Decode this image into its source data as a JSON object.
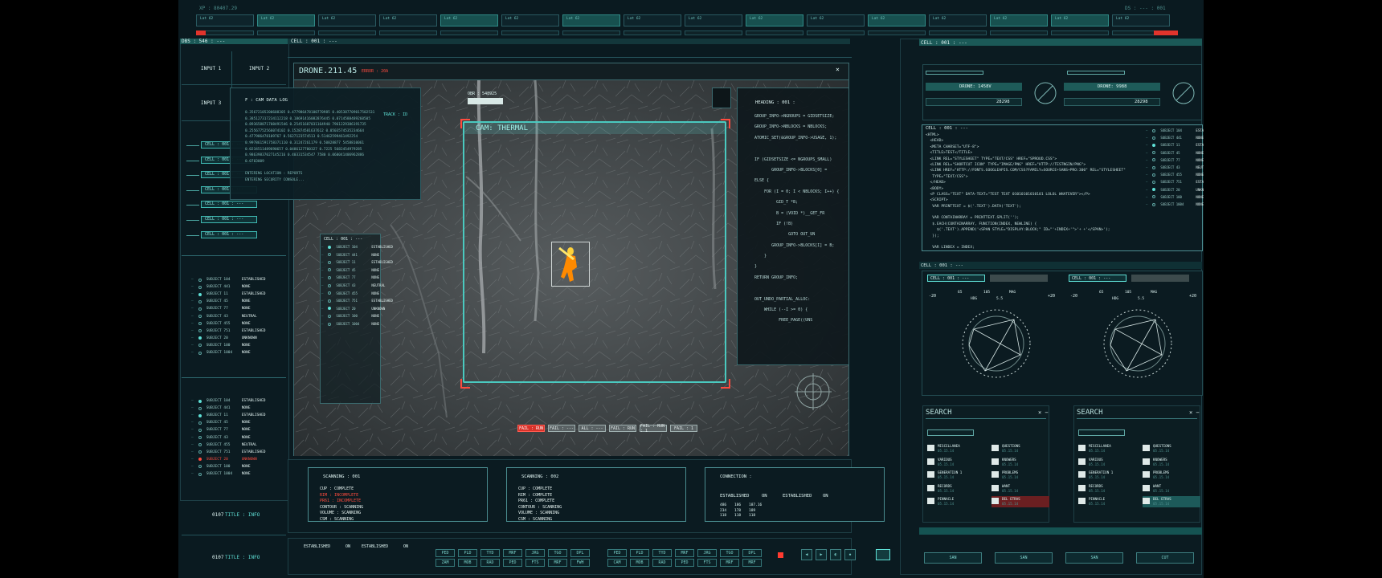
{
  "top": {
    "left_id": "XP : 80407.29",
    "right_id": "DS : --- : 001",
    "lat_label": "Lat 62",
    "lat_boxes": 16
  },
  "left": {
    "header": "DBS : 546 : ---",
    "input1": "INPUT 1",
    "input2": "INPUT 2",
    "input3": "INPUT 3",
    "cells": [
      "CELL : 001 : ---",
      "CELL : 001 : ---",
      "CELL : 001 : ---",
      "CELL : 001 : ---",
      "CELL : 001 : ---",
      "CELL : 001 : ---",
      "CELL : 001 : ---"
    ],
    "subjects_a": [
      {
        "name": "SUBJECT 104",
        "status": "ESTABLISHED",
        "state": "off"
      },
      {
        "name": "SUBJECT 441",
        "status": "NONE",
        "state": "off"
      },
      {
        "name": "SUBJECT 11",
        "status": "ESTABLISHED",
        "state": "on"
      },
      {
        "name": "SUBJECT 45",
        "status": "NONE",
        "state": "off"
      },
      {
        "name": "SUBJECT 77",
        "status": "NONE",
        "state": "off"
      },
      {
        "name": "SUBJECT 43",
        "status": "NEUTRAL",
        "state": "off"
      },
      {
        "name": "SUBJECT 455",
        "status": "NONE",
        "state": "off"
      },
      {
        "name": "SUBJECT 751",
        "status": "ESTABLISHED",
        "state": "off"
      },
      {
        "name": "SUBJECT 20",
        "status": "UNKNOWN",
        "state": "on"
      },
      {
        "name": "SUBJECT 100",
        "status": "NONE",
        "state": "off"
      },
      {
        "name": "SUBJECT 1004",
        "status": "NONE",
        "state": "off"
      }
    ],
    "subjects_b": [
      {
        "name": "SUBJECT 104",
        "status": "ESTABLISHED",
        "state": "on"
      },
      {
        "name": "SUBJECT 441",
        "status": "NONE",
        "state": "off"
      },
      {
        "name": "SUBJECT 11",
        "status": "ESTABLISHED",
        "state": "on"
      },
      {
        "name": "SUBJECT 45",
        "status": "NONE",
        "state": "off"
      },
      {
        "name": "SUBJECT 77",
        "status": "NONE",
        "state": "off"
      },
      {
        "name": "SUBJECT 43",
        "status": "NONE",
        "state": "off"
      },
      {
        "name": "SUBJECT 455",
        "status": "NEUTRAL",
        "state": "off"
      },
      {
        "name": "SUBJECT 751",
        "status": "ESTABLISHED",
        "state": "off"
      },
      {
        "name": "SUBJECT 20",
        "status": "UNKNOWN",
        "state": "red"
      },
      {
        "name": "SUBJECT 100",
        "status": "NONE",
        "state": "off"
      },
      {
        "name": "SUBJECT 1004",
        "status": "NONE",
        "state": "off"
      }
    ],
    "info1_id": "0107",
    "info1_label": "TITLE : INFO",
    "info2_id": "0107",
    "info2_label": "TITLE : INFO"
  },
  "center": {
    "header": "CELL : 001 : ---",
    "drone_title": "DRONE.211.45",
    "drone_sub": "ERROR : 20A",
    "cam_label": "CAM: THERMAL",
    "obr_label": "OBR : 548925",
    "track_label": "TRACK : ID",
    "datalog": {
      "title": "F : CAM DATA LOG",
      "lines": [
        "0.35672105200608305 0.477986478100770985 0.405387709017502531",
        "0.385127317234112218 0.18691416082876445 0.0714588489260505",
        "0.893658871708491546 0.25451687031164940 7961229386191735",
        "0.25567752566074102 0.152874581637612 0.0503574535234664",
        "0.477986478109767 0.5627123574513 0.51462599461492254",
        "0.997861591758371110 0.31247261179 0.50828877 5458810061",
        "0.0234511489690657 0.0486127700327 0.7225 5682454979285",
        "0.98639837027145216 0.40331534547 7580 0.060041406962886",
        "0.0703009",
        "",
        "ENTERING LOCATION : REPORTS",
        "ENTERING SECURITY CONSOLE..."
      ]
    },
    "subject_list_title": "CELL : 001 : ---",
    "subject_list": [
      {
        "name": "SUBJECT 104",
        "status": "ESTABLISHED",
        "state": "on"
      },
      {
        "name": "SUBJECT 441",
        "status": "NONE",
        "state": "off"
      },
      {
        "name": "SUBJECT 11",
        "status": "ESTABLISHED",
        "state": "off"
      },
      {
        "name": "SUBJECT 45",
        "status": "NONE",
        "state": "off"
      },
      {
        "name": "SUBJECT 77",
        "status": "NONE",
        "state": "off"
      },
      {
        "name": "SUBJECT 43",
        "status": "NEUTRAL",
        "state": "off"
      },
      {
        "name": "SUBJECT 455",
        "status": "NONE",
        "state": "off"
      },
      {
        "name": "SUBJECT 751",
        "status": "ESTABLISHED",
        "state": "off"
      },
      {
        "name": "SUBJECT 20",
        "status": "UNKNOWN",
        "state": "on"
      },
      {
        "name": "SUBJECT 100",
        "status": "NONE",
        "state": "off"
      },
      {
        "name": "SUBJECT 1004",
        "status": "NONE",
        "state": "off"
      }
    ],
    "heading_title": "HEADING : 001 :",
    "heading_code": [
      "GROUP_INFO->NGROUPS = GIDSETSIZE;",
      "GROUP_INFO->NBLOCKS = NBLOCKS;",
      "ATOMIC_SET(&GROUP_INFO->USAGE, 1);",
      "",
      "IF (GIDSETSIZE <= NGROUPS_SMALL)",
      "       GROUP_INFO->BLOCKS[0] =",
      "ELSE {",
      "    FOR (I = 0; I < NBLOCKS; I++) {",
      "         GID_T *B;",
      "         B = (VOID *)__GET_FR",
      "         IF (!B)",
      "              GOTO OUT_UN",
      "       GROUP_INFO->BLOCKS[I] = B;",
      "    }",
      "}",
      "RETURN GROUP_INFO;",
      "",
      "OUT_UNDO_PARTIAL_ALLOC:",
      "    WHILE (--I >= 0) {",
      "          FREE_PAGE((UNS"
    ],
    "bottom_buttons": [
      "FAIL : RUN",
      "FAIL : ---",
      "ALL : ---",
      "FAIL : RUN",
      "FAIL : RUN : 1",
      "FAIL : 1"
    ],
    "scan1": {
      "title": "SCANNING : 001",
      "lines": [
        {
          "t": "CUP : COMPLETE",
          "c": "white"
        },
        {
          "t": "RIM : INCOMPLETE",
          "c": "red"
        },
        {
          "t": "PR61 : INCOMPLETE",
          "c": "red"
        },
        {
          "t": "CONTOUR : SCANNING",
          "c": "white"
        },
        {
          "t": "VOLUME : SCANNING",
          "c": "white"
        },
        {
          "t": "CSM : SCANNING",
          "c": "white"
        }
      ]
    },
    "scan2": {
      "title": "SCANNING : 002",
      "lines": [
        {
          "t": "CUP : COMPLETE",
          "c": "white"
        },
        {
          "t": "RIM : COMPLETE",
          "c": "white"
        },
        {
          "t": "PR61 : COMPLETE",
          "c": "white"
        },
        {
          "t": "CONTOUR : SCANNING",
          "c": "white"
        },
        {
          "t": "VOLUME : SCANNING",
          "c": "white"
        },
        {
          "t": "CSM : SCANNING",
          "c": "white"
        }
      ]
    },
    "connection": {
      "title": "CONNECTION :",
      "est1": "ESTABLISHED",
      "on1": "ON",
      "est2": "ESTABLISHED",
      "on2": "ON",
      "row1": [
        "486",
        "186",
        "187.16"
      ],
      "row2": [
        "234",
        "178",
        "189"
      ],
      "row3": [
        "118",
        "118",
        "118"
      ]
    },
    "ctl_row1": [
      "PED",
      "PLD",
      "TYD",
      "MRF",
      "JRG",
      "TGO",
      "DPL"
    ],
    "ctl_row2": [
      "ZAM",
      "MOB",
      "RAD",
      "PED",
      "FTS",
      "MRF",
      "FWH"
    ],
    "ctl2_row1": [
      "PED",
      "PLD",
      "TYD",
      "MRF",
      "JRG",
      "TGO",
      "DPL"
    ],
    "ctl2_row2": [
      "CAM",
      "MOB",
      "RAD",
      "PED",
      "FTS",
      "MRF",
      "MRF"
    ],
    "est_bottom": [
      "ESTABLISHED",
      "ON",
      "ESTABLISHED",
      "ON"
    ]
  },
  "right": {
    "header": "CELL : 001 : ---",
    "drone1": "DRONE: 1458V",
    "drone1_val": "28298",
    "drone2": "DRONE: 9988",
    "drone2_val": "28298",
    "code_title": "CELL : 001 : ---",
    "code_lines": [
      "<HTML>",
      "  <HEAD>",
      "  <META CHARSET=\"UTF-8\">",
      "  <TITLE>TEST</TITLE>",
      "  <LINK REL=\"STYLESHEET\" TYPE=\"TEXT/CSS\" HREF=\"SPROUD.CSS\">",
      "  <LINK REL=\"SHORTCUT ICON\" TYPE=\"IMAGE/PNG\" HREF=\"HTTP://TESTNGIN/PNG\">",
      "  <LINK HREF=\"HTTP://FONTS.GOOGLEAPIS.COM/CSS?FAMILY=SOURCE+SANS+PRO:300\" REL=\"STYLESHEET\"",
      "   TYPE=\"TEXT/CSS\">",
      "  </HEAD>",
      "  <BODY>",
      "  <P CLASS=\"TEXT\" DATA-TEXT=\"TEST TEXT 01010101010101 LOLOL WHATEVER\"></P>",
      "  <SCRIPT>",
      "   VAR PRINTTEXT = $('.TEXT').DATA('TEXT');",
      "",
      "   VAR CONTAINARRAY = PRINTTEXT.SPLIT('');",
      "   $.EACH(CONTAINARRAY, FUNCTION(INDEX, NEWLINE) {",
      "     $('.TEXT').APPEND('<SPAN STYLE=\"DISPLAY:BLOCK;\" ID=\"'+INDEX+'\">'+ +'</SPAN>');",
      "   });",
      "",
      "   VAR LINDEX = INDEX;"
    ],
    "subjects": [
      {
        "name": "SUBJECT 104",
        "status": "ESTABLISHED",
        "state": "off"
      },
      {
        "name": "SUBJECT 441",
        "status": "NONE",
        "state": "off"
      },
      {
        "name": "SUBJECT 11",
        "status": "ESTABLISHED",
        "state": "on"
      },
      {
        "name": "SUBJECT 45",
        "status": "NONE",
        "state": "off"
      },
      {
        "name": "SUBJECT 77",
        "status": "NONE",
        "state": "off"
      },
      {
        "name": "SUBJECT 43",
        "status": "NEUTRAL",
        "state": "off"
      },
      {
        "name": "SUBJECT 455",
        "status": "NONE",
        "state": "off"
      },
      {
        "name": "SUBJECT 751",
        "status": "ESTABLISHED",
        "state": "off"
      },
      {
        "name": "SUBJECT 20",
        "status": "UNKNOWN",
        "state": "on"
      },
      {
        "name": "SUBJECT 100",
        "status": "NONE",
        "state": "off"
      },
      {
        "name": "SUBJECT 1004",
        "status": "NONE",
        "state": "off"
      }
    ],
    "radar_header": "CELL : 001 : ---",
    "radar_cell": "CELL : 001 : ---",
    "radar_nums": [
      "-20",
      "+20"
    ],
    "radar_tags": [
      "65",
      "HDG",
      "105",
      "5.5",
      "MAG"
    ],
    "search_title": "SEARCH",
    "search_items": [
      {
        "name": "MISCELLANEA",
        "date": "05.15.14"
      },
      {
        "name": "QUESTIONS",
        "date": "05.15.14"
      },
      {
        "name": "VARIOUS",
        "date": "05.15.14"
      },
      {
        "name": "KNOWERS",
        "date": "05.15.14"
      },
      {
        "name": "GENERATION 1",
        "date": "05.15.14"
      },
      {
        "name": "PROBLEMS",
        "date": "05.15.14"
      },
      {
        "name": "RECORDS",
        "date": "05.15.14"
      },
      {
        "name": "WANT",
        "date": "05.15.14"
      },
      {
        "name": "PINNACLE",
        "date": "05.15.14"
      },
      {
        "name": "DEL ETRAS",
        "date": "05.15.14"
      }
    ],
    "bottom_btns": [
      "SAN",
      "SAN",
      "SAN",
      "CUT"
    ]
  },
  "colors": {
    "accent": "#5fe0d6",
    "danger": "#ff4b3e",
    "bg": "#0a1a20",
    "thermal": "#ff8a00"
  }
}
